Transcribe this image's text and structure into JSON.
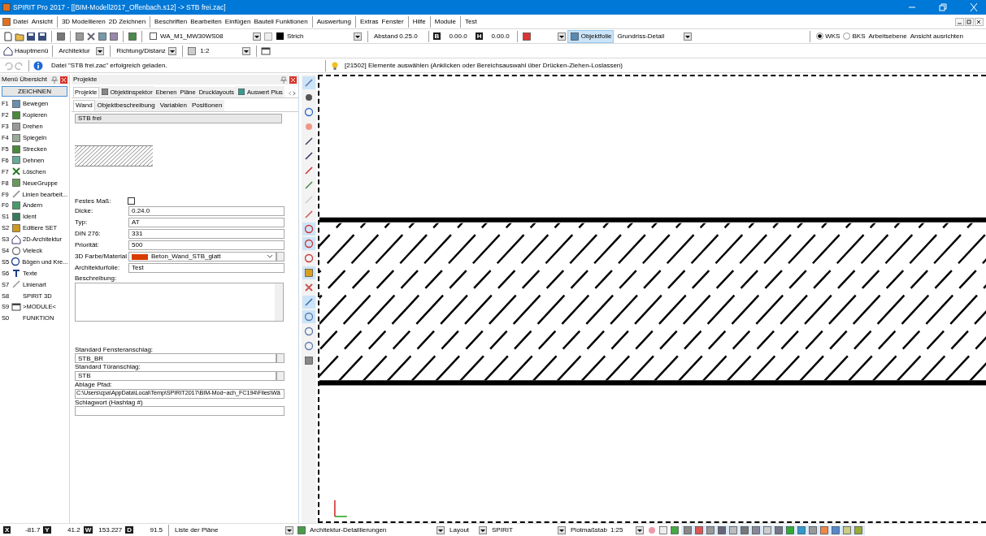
{
  "window": {
    "title": "SPIRIT Pro 2017  - [[BIM-Modell2017_Offenbach.s12] -> STB frei.zac]"
  },
  "menu": [
    {
      "label": "Datei",
      "sep": false
    },
    {
      "label": "Ansicht",
      "sep": true
    },
    {
      "label": "3D Modellieren",
      "sep": false
    },
    {
      "label": "2D Zeichnen",
      "sep": true
    },
    {
      "label": "Beschriften",
      "sep": false
    },
    {
      "label": "Bearbeiten",
      "sep": false
    },
    {
      "label": "Einfügen",
      "sep": false
    },
    {
      "label": "Bauteil Funktionen",
      "sep": true
    },
    {
      "label": "Auswertung",
      "sep": true
    },
    {
      "label": "Extras",
      "sep": false
    },
    {
      "label": "Fenster",
      "sep": true
    },
    {
      "label": "Hilfe",
      "sep": true
    },
    {
      "label": "Module",
      "sep": true
    },
    {
      "label": "Test",
      "sep": false
    }
  ],
  "toolbar": {
    "layer_checked": false,
    "layer": "WA_M1_MW30WS08",
    "linetype": "Strich",
    "abstand_label": "Abstand",
    "abstand": "0.25.0",
    "b_label": "B",
    "b_value": "0.00.0",
    "h_label": "H",
    "h_value": "0.00.0",
    "objektfolie": {
      "label": "Objektfolie",
      "selected": true
    },
    "view": "Grundriss-Detail",
    "coords": [
      {
        "label": "WKS",
        "selected": true
      },
      {
        "label": "BKS",
        "selected": false
      }
    ],
    "arbeitsebene": "Arbeitsebene",
    "ansicht": "Ansicht ausrichten"
  },
  "toolbar2": {
    "home": "Hauptmenü",
    "module": "Architektur",
    "mode": "Richtung/Distanz",
    "scale": "1:2"
  },
  "messages": {
    "info": "Datei \"STB frei.zac\" erfolgreich geladen.",
    "prompt": "[21502] Elemente auswählen (Anklicken oder Bereichsauswahl über Drücken-Ziehen-Loslassen)"
  },
  "menu_panel": {
    "title": "Menü Übersicht",
    "button": "ZEICHNEN",
    "items": [
      {
        "key": "F1",
        "label": "Bewegen",
        "icon": true
      },
      {
        "key": "F2",
        "label": "Kopieren",
        "icon": true
      },
      {
        "key": "F3",
        "label": "Drehen",
        "icon": true
      },
      {
        "key": "F4",
        "label": "Spiegeln",
        "icon": true
      },
      {
        "key": "F5",
        "label": "Strecken",
        "icon": true
      },
      {
        "key": "F6",
        "label": "Dehnen",
        "icon": true
      },
      {
        "key": "F7",
        "label": "Löschen",
        "icon": true
      },
      {
        "key": "F8",
        "label": "NeueGruppe",
        "icon": true
      },
      {
        "key": "F9",
        "label": "Linien bearbeit...",
        "icon": true
      },
      {
        "key": "F0",
        "label": "Ändern",
        "icon": true
      },
      {
        "key": "S1",
        "label": "Ident",
        "icon": true
      },
      {
        "key": "S2",
        "label": "Editiere SET",
        "icon": true
      },
      {
        "key": "S3",
        "label": "2D-Architektur",
        "icon": true
      },
      {
        "key": "S4",
        "label": "Vieleck",
        "icon": true
      },
      {
        "key": "S5",
        "label": "Bögen und Kre...",
        "icon": true
      },
      {
        "key": "S6",
        "label": "Texte",
        "icon": true
      },
      {
        "key": "S7",
        "label": "Linienart",
        "icon": true
      },
      {
        "key": "S8",
        "label": "SPIRIT 3D",
        "icon": false
      },
      {
        "key": "S9",
        "label": ">MODULE<",
        "icon": true
      },
      {
        "key": "S0",
        "label": "FUNKTION",
        "icon": false
      }
    ]
  },
  "projects_panel": {
    "title": "Projekte",
    "tabs": [
      {
        "label": "Projekte",
        "selected": true,
        "icon": false
      },
      {
        "label": "Objektinspektor",
        "selected": false,
        "icon": true
      },
      {
        "label": "Ebenen",
        "selected": false,
        "icon": false
      },
      {
        "label": "Pläne",
        "selected": false,
        "icon": false
      },
      {
        "label": "Drucklayouts",
        "selected": false,
        "icon": false
      },
      {
        "label": "Auswert Plus",
        "selected": false,
        "icon": true
      }
    ],
    "subtabs": [
      {
        "label": "Wand",
        "selected": true
      },
      {
        "label": "Objektbeschreibung",
        "selected": false
      },
      {
        "label": "Variablen",
        "selected": false
      },
      {
        "label": "Positionen",
        "selected": false
      }
    ],
    "name": "STB frei",
    "festes_mass": {
      "label": "Festes Maß:",
      "checked": false
    },
    "fields": [
      {
        "label": "Dicke:",
        "value": "0.24.0"
      },
      {
        "label": "Typ:",
        "value": "AT"
      },
      {
        "label": "DIN 276:",
        "value": "331"
      },
      {
        "label": "Priorität:",
        "value": "500"
      }
    ],
    "material": {
      "label": "3D Farbe/Material",
      "value": "Beton_Wand_STB_glatt",
      "color": "#d83b01"
    },
    "architekturfolie": {
      "label": "Architekturfolie:",
      "value": "Test"
    },
    "beschreibung": {
      "label": "Beschreibung:"
    },
    "lower_fields": [
      {
        "label": "Standard Fensteranschlag:",
        "value": "STB_BR",
        "browse": true
      },
      {
        "label": "Standard Türanschlag:",
        "value": "STB",
        "browse": true
      },
      {
        "label": "Ablage Pfad:",
        "value": "C:\\Users\\cpa\\AppData\\Local\\Temp\\SPIRIT2017\\BIM-Mod~ach_FC194\\Files\\Wä",
        "browse": false
      },
      {
        "label": "Schlagwort (Hashtag #)",
        "browse": false
      }
    ]
  },
  "side_toolbar": [
    {
      "selected": true
    },
    {
      "selected": false
    },
    {
      "selected": false
    },
    {
      "selected": false
    },
    {
      "selected": false
    },
    {
      "selected": false
    },
    {
      "selected": false
    },
    {
      "selected": false
    },
    {
      "selected": false
    },
    {
      "selected": false
    },
    {
      "selected": true
    },
    {
      "selected": true
    },
    {
      "selected": false
    },
    {
      "selected": true
    },
    {
      "selected": false
    },
    {
      "selected": true
    },
    {
      "selected": true
    },
    {
      "selected": false
    },
    {
      "selected": false
    },
    {
      "selected": false
    }
  ],
  "status_bar": {
    "coords": [
      {
        "label": "X",
        "value": "-81.7"
      },
      {
        "label": "Y",
        "value": "41.2"
      },
      {
        "label": "W",
        "value": "153.227"
      },
      {
        "label": "D",
        "value": "91.5"
      }
    ],
    "plans": "Liste der Pläne",
    "detail": "Architektur-Detaillierungen",
    "layout": "Layout",
    "style": "SPIRIT",
    "plot_label": "Plotmaßstab",
    "plot_scale": "1:25"
  }
}
